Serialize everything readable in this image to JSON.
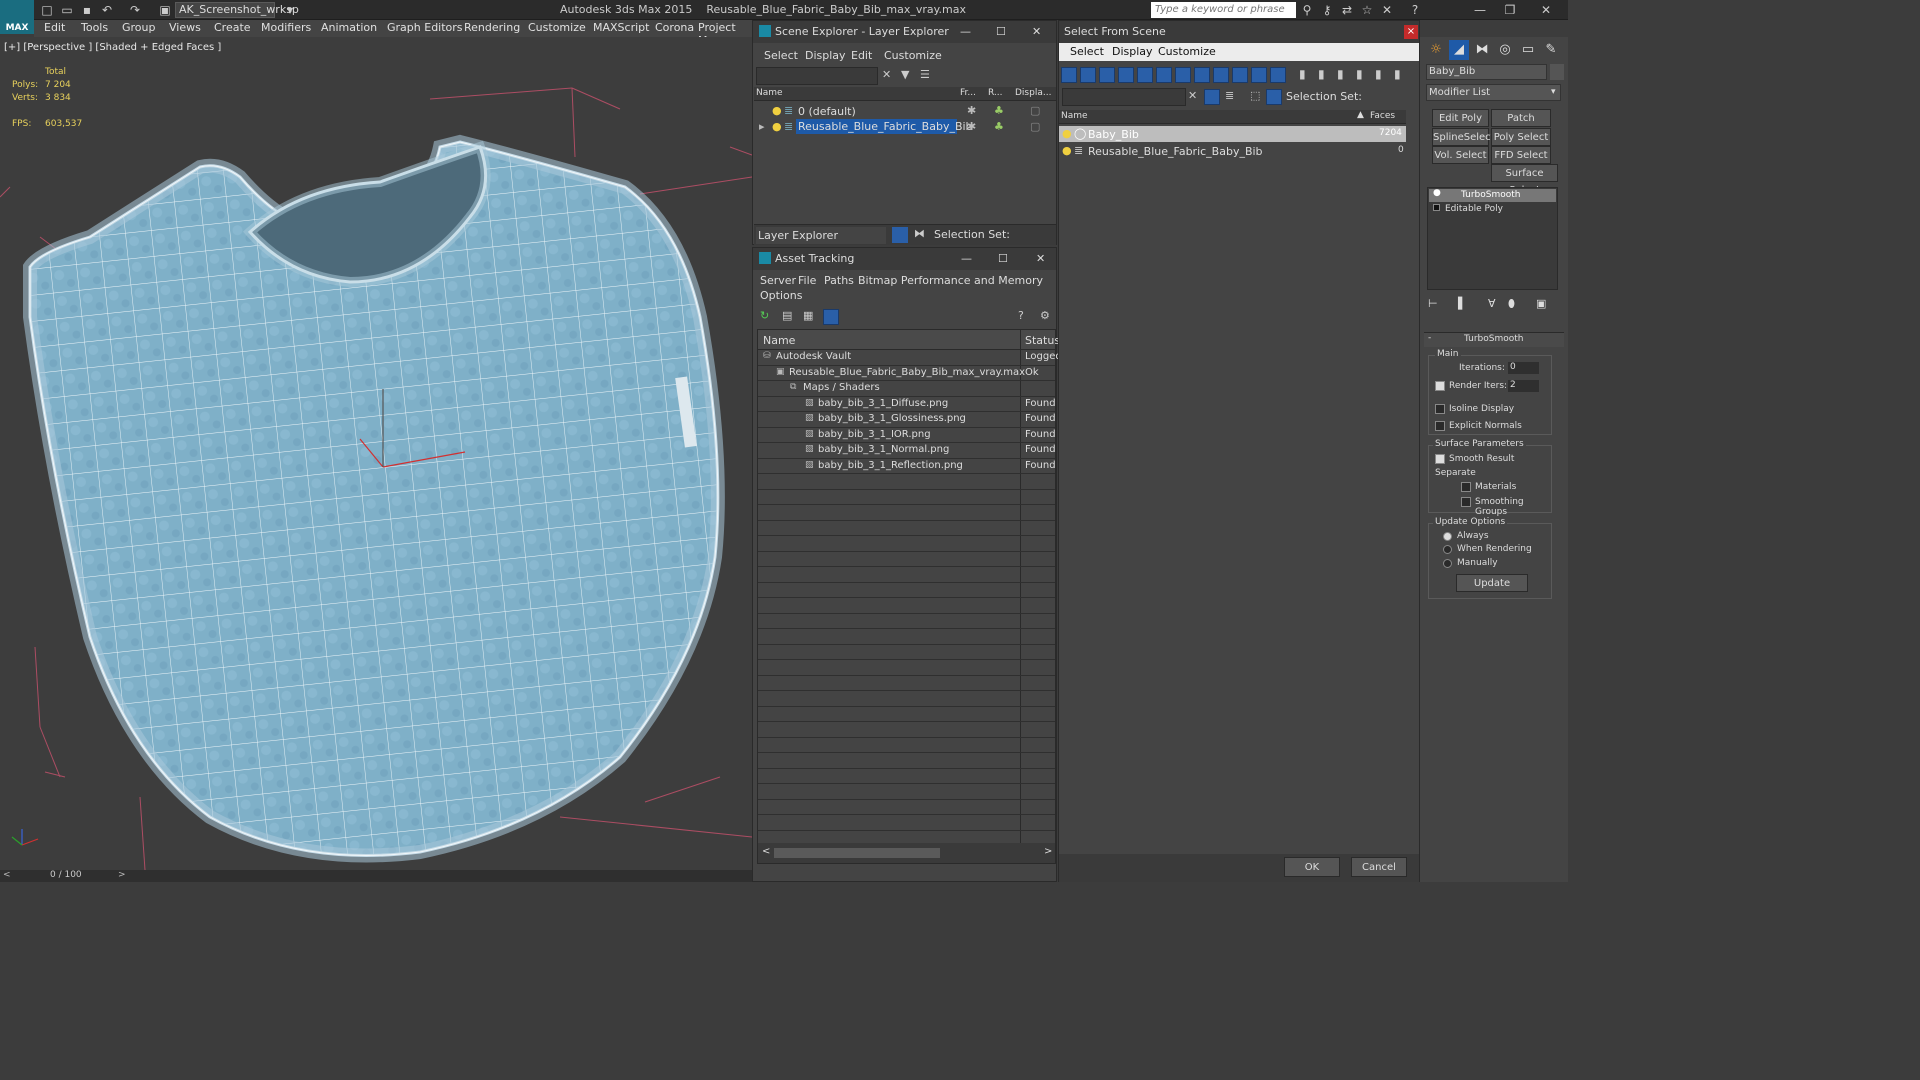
{
  "app": {
    "logo": "MAX",
    "workspace": "AK_Screenshot_wrksp",
    "title": "Autodesk 3ds Max 2015",
    "filename": "Reusable_Blue_Fabric_Baby_Bib_max_vray.max",
    "search_placeholder": "Type a keyword or phrase"
  },
  "menu": [
    "Edit",
    "Tools",
    "Group",
    "Views",
    "Create",
    "Modifiers",
    "Animation",
    "Graph Editors",
    "Rendering",
    "Customize",
    "MAXScript",
    "Corona",
    "Project Man"
  ],
  "viewport": {
    "label": "[+] [Perspective ] [Shaded + Edged Faces ]",
    "stats_total_label": "Total",
    "polys_label": "Polys:",
    "polys_value": "7 204",
    "verts_label": "Verts:",
    "verts_value": "3 834",
    "fps_label": "FPS:",
    "fps_value": "603,537"
  },
  "timeline": {
    "frame": "0 / 100"
  },
  "scene_explorer": {
    "title": "Scene Explorer - Layer Explorer",
    "menus": [
      "Select",
      "Display",
      "Edit",
      "Customize"
    ],
    "columns": [
      "Name",
      "Fr...",
      "R...",
      "Displa..."
    ],
    "rows": [
      "0 (default)",
      "Reusable_Blue_Fabric_Baby_Bib"
    ],
    "footer_select": "Layer Explorer",
    "selection_set_label": "Selection Set:"
  },
  "asset_tracking": {
    "title": "Asset Tracking",
    "menus": [
      "Server",
      "File",
      "Paths",
      "Bitmap Performance and Memory"
    ],
    "menu_options": "Options",
    "columns": [
      "Name",
      "Status"
    ],
    "rows": [
      {
        "name": "Autodesk Vault",
        "status": "Logged"
      },
      {
        "name": "Reusable_Blue_Fabric_Baby_Bib_max_vray.max",
        "status": "Ok"
      },
      {
        "name": "Maps / Shaders",
        "status": ""
      },
      {
        "name": "baby_bib_3_1_Diffuse.png",
        "status": "Found"
      },
      {
        "name": "baby_bib_3_1_Glossiness.png",
        "status": "Found"
      },
      {
        "name": "baby_bib_3_1_IOR.png",
        "status": "Found"
      },
      {
        "name": "baby_bib_3_1_Normal.png",
        "status": "Found"
      },
      {
        "name": "baby_bib_3_1_Reflection.png",
        "status": "Found"
      }
    ]
  },
  "select_from_scene": {
    "title": "Select From Scene",
    "menus": [
      "Select",
      "Display",
      "Customize"
    ],
    "selection_set_label": "Selection Set:",
    "columns": [
      "Name",
      "Faces"
    ],
    "rows": [
      {
        "name": "Baby_Bib",
        "faces": "7204"
      },
      {
        "name": "Reusable_Blue_Fabric_Baby_Bib",
        "faces": "0"
      }
    ],
    "ok": "OK",
    "cancel": "Cancel"
  },
  "command_panel": {
    "object_name": "Baby_Bib",
    "modifier_list": "Modifier List",
    "buttons": [
      "Edit Poly",
      "Patch Select",
      "SplineSelect",
      "Poly Select",
      "Vol. Select",
      "FFD Select",
      "Surface Select"
    ],
    "stack": [
      "TurboSmooth",
      "Editable Poly"
    ],
    "rollout_title": "TurboSmooth",
    "main_label": "Main",
    "iterations_label": "Iterations:",
    "iterations_value": "0",
    "render_iters_label": "Render Iters:",
    "render_iters_value": "2",
    "isoline_label": "Isoline Display",
    "explicit_normals_label": "Explicit Normals",
    "surface_params_label": "Surface Parameters",
    "smooth_result_label": "Smooth Result",
    "separate_label": "Separate",
    "materials_label": "Materials",
    "smoothing_groups_label": "Smoothing Groups",
    "update_options_label": "Update Options",
    "always_label": "Always",
    "when_rendering_label": "When Rendering",
    "manually_label": "Manually",
    "update_button": "Update"
  }
}
